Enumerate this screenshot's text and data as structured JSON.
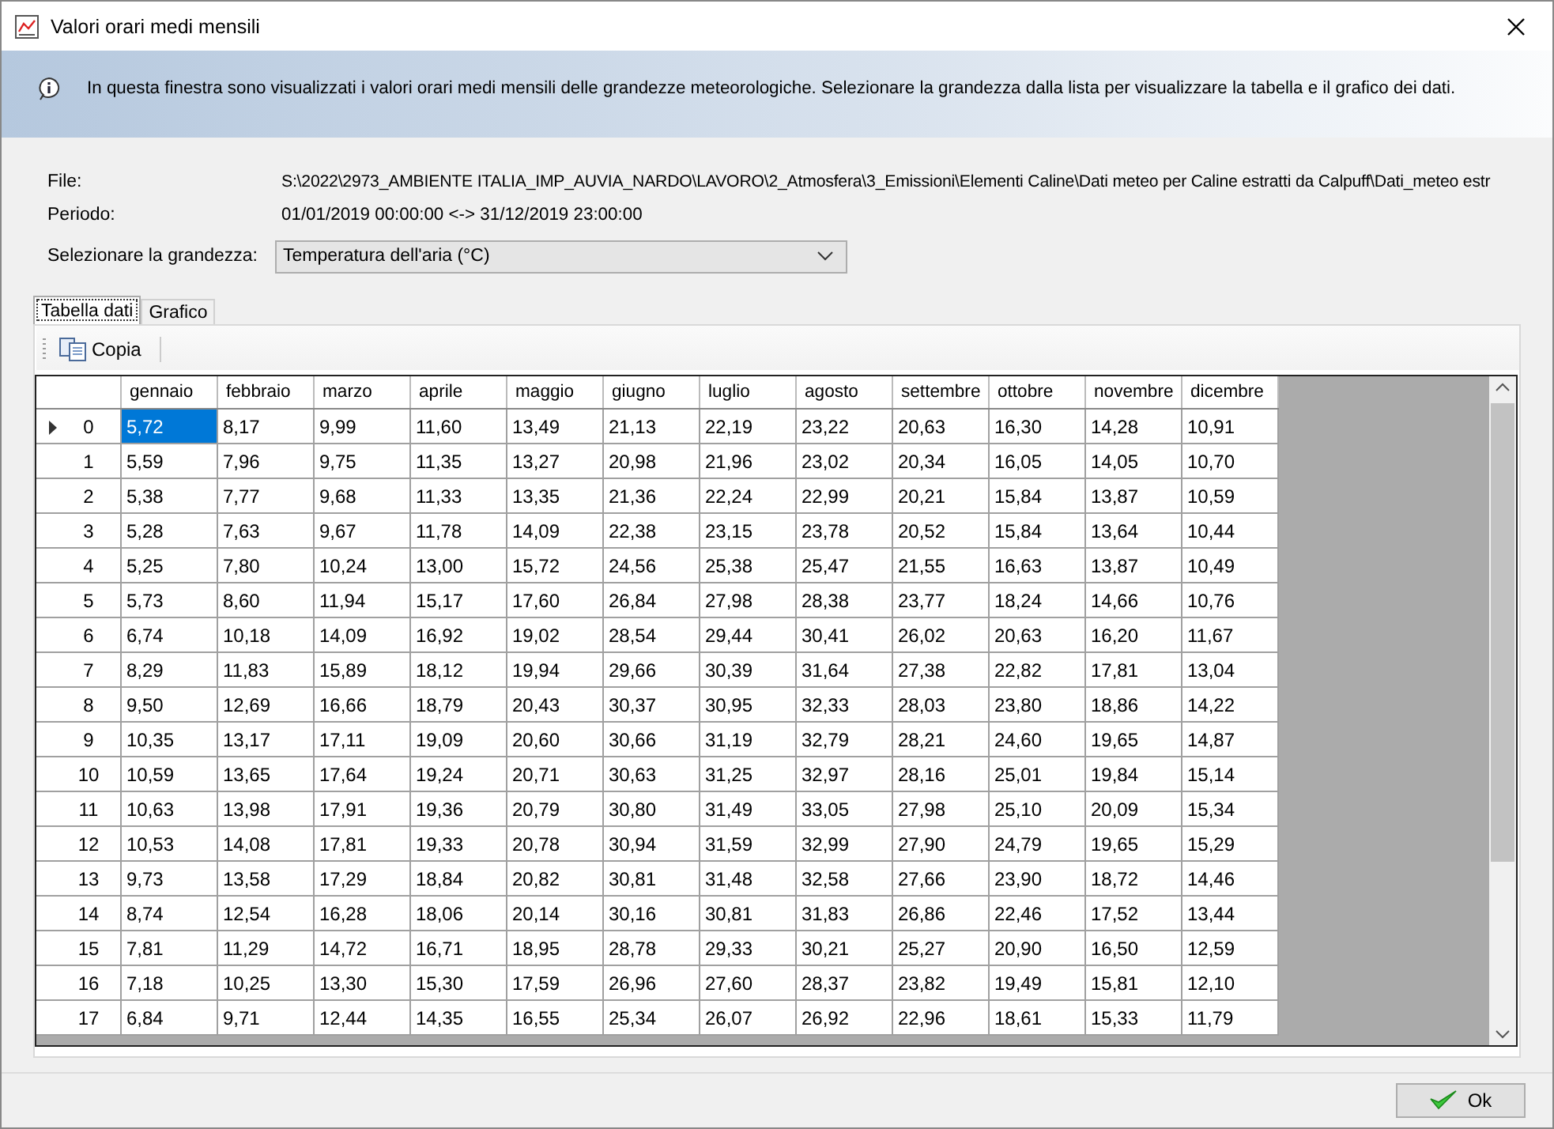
{
  "window": {
    "title": "Valori orari medi mensili"
  },
  "info": "In questa finestra sono visualizzati i valori orari medi mensili delle grandezze meteorologiche. Selezionare la grandezza dalla lista per visualizzare la tabella e il grafico dei dati.",
  "file": {
    "label": "File:",
    "value": "S:\\2022\\2973_AMBIENTE ITALIA_IMP_AUVIA_NARDO\\LAVORO\\2_Atmosfera\\3_Emissioni\\Elementi Caline\\Dati meteo per Caline estratti da Calpuff\\Dati_meteo estr"
  },
  "period": {
    "label": "Periodo:",
    "value": "01/01/2019 00:00:00 <-> 31/12/2019 23:00:00"
  },
  "quantity": {
    "label": "Selezionare la grandezza:",
    "value": "Temperatura dell'aria (°C)"
  },
  "tabs": [
    {
      "label": "Tabella dati",
      "selected": true
    },
    {
      "label": "Grafico",
      "selected": false
    }
  ],
  "toolbar": {
    "copy": "Copia"
  },
  "table": {
    "columns": [
      "gennaio",
      "febbraio",
      "marzo",
      "aprile",
      "maggio",
      "giugno",
      "luglio",
      "agosto",
      "settembre",
      "ottobre",
      "novembre",
      "dicembre"
    ],
    "rows": [
      {
        "label": "0",
        "selected": true,
        "values": [
          "5,72",
          "8,17",
          "9,99",
          "11,60",
          "13,49",
          "21,13",
          "22,19",
          "23,22",
          "20,63",
          "16,30",
          "14,28",
          "10,91"
        ]
      },
      {
        "label": "1",
        "selected": false,
        "values": [
          "5,59",
          "7,96",
          "9,75",
          "11,35",
          "13,27",
          "20,98",
          "21,96",
          "23,02",
          "20,34",
          "16,05",
          "14,05",
          "10,70"
        ]
      },
      {
        "label": "2",
        "selected": false,
        "values": [
          "5,38",
          "7,77",
          "9,68",
          "11,33",
          "13,35",
          "21,36",
          "22,24",
          "22,99",
          "20,21",
          "15,84",
          "13,87",
          "10,59"
        ]
      },
      {
        "label": "3",
        "selected": false,
        "values": [
          "5,28",
          "7,63",
          "9,67",
          "11,78",
          "14,09",
          "22,38",
          "23,15",
          "23,78",
          "20,52",
          "15,84",
          "13,64",
          "10,44"
        ]
      },
      {
        "label": "4",
        "selected": false,
        "values": [
          "5,25",
          "7,80",
          "10,24",
          "13,00",
          "15,72",
          "24,56",
          "25,38",
          "25,47",
          "21,55",
          "16,63",
          "13,87",
          "10,49"
        ]
      },
      {
        "label": "5",
        "selected": false,
        "values": [
          "5,73",
          "8,60",
          "11,94",
          "15,17",
          "17,60",
          "26,84",
          "27,98",
          "28,38",
          "23,77",
          "18,24",
          "14,66",
          "10,76"
        ]
      },
      {
        "label": "6",
        "selected": false,
        "values": [
          "6,74",
          "10,18",
          "14,09",
          "16,92",
          "19,02",
          "28,54",
          "29,44",
          "30,41",
          "26,02",
          "20,63",
          "16,20",
          "11,67"
        ]
      },
      {
        "label": "7",
        "selected": false,
        "values": [
          "8,29",
          "11,83",
          "15,89",
          "18,12",
          "19,94",
          "29,66",
          "30,39",
          "31,64",
          "27,38",
          "22,82",
          "17,81",
          "13,04"
        ]
      },
      {
        "label": "8",
        "selected": false,
        "values": [
          "9,50",
          "12,69",
          "16,66",
          "18,79",
          "20,43",
          "30,37",
          "30,95",
          "32,33",
          "28,03",
          "23,80",
          "18,86",
          "14,22"
        ]
      },
      {
        "label": "9",
        "selected": false,
        "values": [
          "10,35",
          "13,17",
          "17,11",
          "19,09",
          "20,60",
          "30,66",
          "31,19",
          "32,79",
          "28,21",
          "24,60",
          "19,65",
          "14,87"
        ]
      },
      {
        "label": "10",
        "selected": false,
        "values": [
          "10,59",
          "13,65",
          "17,64",
          "19,24",
          "20,71",
          "30,63",
          "31,25",
          "32,97",
          "28,16",
          "25,01",
          "19,84",
          "15,14"
        ]
      },
      {
        "label": "11",
        "selected": false,
        "values": [
          "10,63",
          "13,98",
          "17,91",
          "19,36",
          "20,79",
          "30,80",
          "31,49",
          "33,05",
          "27,98",
          "25,10",
          "20,09",
          "15,34"
        ]
      },
      {
        "label": "12",
        "selected": false,
        "values": [
          "10,53",
          "14,08",
          "17,81",
          "19,33",
          "20,78",
          "30,94",
          "31,59",
          "32,99",
          "27,90",
          "24,79",
          "19,65",
          "15,29"
        ]
      },
      {
        "label": "13",
        "selected": false,
        "values": [
          "9,73",
          "13,58",
          "17,29",
          "18,84",
          "20,82",
          "30,81",
          "31,48",
          "32,58",
          "27,66",
          "23,90",
          "18,72",
          "14,46"
        ]
      },
      {
        "label": "14",
        "selected": false,
        "values": [
          "8,74",
          "12,54",
          "16,28",
          "18,06",
          "20,14",
          "30,16",
          "30,81",
          "31,83",
          "26,86",
          "22,46",
          "17,52",
          "13,44"
        ]
      },
      {
        "label": "15",
        "selected": false,
        "values": [
          "7,81",
          "11,29",
          "14,72",
          "16,71",
          "18,95",
          "28,78",
          "29,33",
          "30,21",
          "25,27",
          "20,90",
          "16,50",
          "12,59"
        ]
      },
      {
        "label": "16",
        "selected": false,
        "values": [
          "7,18",
          "10,25",
          "13,30",
          "15,30",
          "17,59",
          "26,96",
          "27,60",
          "28,37",
          "23,82",
          "19,49",
          "15,81",
          "12,10"
        ]
      },
      {
        "label": "17",
        "selected": false,
        "values": [
          "6,84",
          "9,71",
          "12,44",
          "14,35",
          "16,55",
          "25,34",
          "26,07",
          "26,92",
          "22,96",
          "18,61",
          "15,33",
          "11,79"
        ]
      }
    ]
  },
  "buttons": {
    "ok": "Ok"
  }
}
